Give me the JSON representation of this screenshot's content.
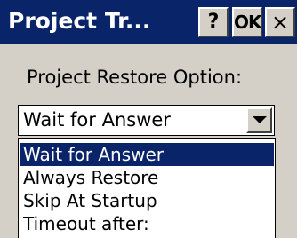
{
  "window": {
    "title": "Project Tr...",
    "help_label": "?",
    "ok_label": "OK",
    "close_label": "×"
  },
  "form": {
    "option_label": "Project Restore Option:",
    "combo": {
      "selected_value": "Wait for Answer",
      "options": [
        "Wait for Answer",
        "Always Restore",
        "Skip At Startup",
        "Timeout after:"
      ],
      "highlighted_index": 0
    }
  },
  "colors": {
    "titlebar": "#0a246a",
    "highlight": "#0a246a",
    "face": "#d4d0c8"
  },
  "icons": {
    "combo_button": "chevron-down-icon"
  }
}
